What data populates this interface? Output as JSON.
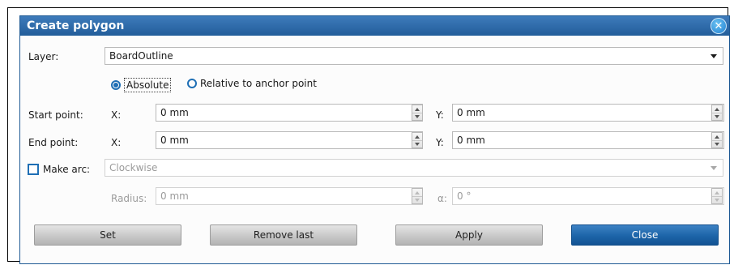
{
  "dialog": {
    "title": "Create polygon",
    "close_glyph": "✕"
  },
  "layer": {
    "label": "Layer:",
    "value": "BoardOutline"
  },
  "coord_mode": {
    "options": [
      {
        "label": "Absolute",
        "selected": true
      },
      {
        "label": "Relative to anchor point",
        "selected": false
      }
    ]
  },
  "start_point": {
    "label": "Start point:",
    "x_label": "X:",
    "x_value": "0 mm",
    "y_label": "Y:",
    "y_value": "0 mm"
  },
  "end_point": {
    "label": "End point:",
    "x_label": "X:",
    "x_value": "0 mm",
    "y_label": "Y:",
    "y_value": "0 mm"
  },
  "arc": {
    "checkbox_label": "Make arc:",
    "checked": false,
    "direction_value": "Clockwise",
    "radius_label": "Radius:",
    "radius_value": "0 mm",
    "angle_label": "α:",
    "angle_value": "0 °"
  },
  "buttons": {
    "set": "Set",
    "remove_last": "Remove last",
    "apply": "Apply",
    "close": "Close"
  },
  "colors": {
    "accent": "#1f6fb5",
    "titlebar": "#2d6aa8",
    "primary_button": "#1c64a8"
  }
}
